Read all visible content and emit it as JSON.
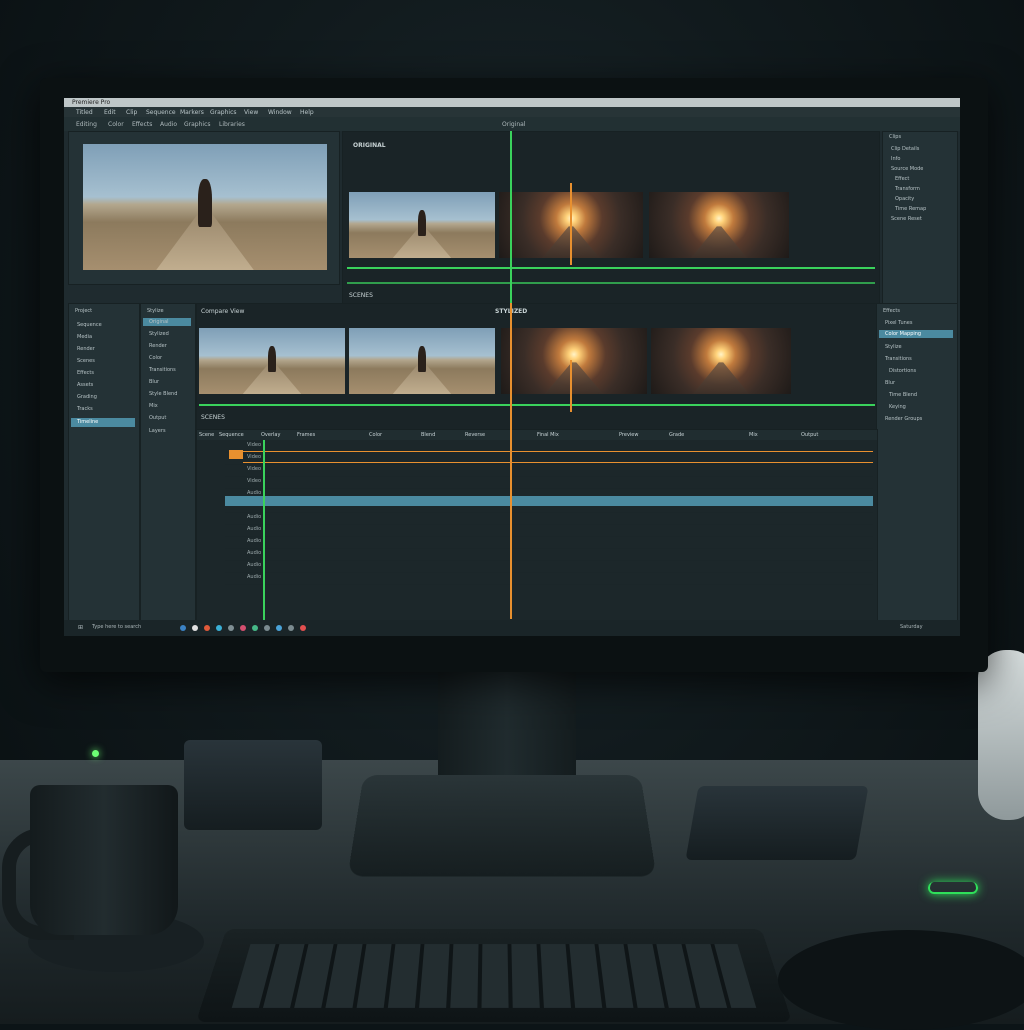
{
  "window": {
    "title": "Premiere Pro"
  },
  "colors": {
    "playhead_green": "#3ad25c",
    "playhead_orange": "#e8902f",
    "selected_track": "#4b8aa0",
    "bg": "#1f2b2f"
  },
  "menu": [
    "Titled",
    "Edit",
    "Clip",
    "Sequence",
    "Markers",
    "Graphics",
    "View",
    "Window",
    "Help"
  ],
  "toolbar": [
    "Editing",
    "Color",
    "Effects",
    "Audio",
    "Graphics",
    "Libraries"
  ],
  "top_bar_center": "Original",
  "viewers": {
    "original_label": "ORIGINAL",
    "stylized_label": "STYLIZED",
    "source_panel_title": "Compare View",
    "scenes_label": "SCENES",
    "original_footer": "SCENES"
  },
  "right_panel_top": {
    "header": "Clips",
    "items": [
      "Clip Details",
      "Info",
      "Source Mode",
      "Effect",
      "Transform",
      "Opacity",
      "Time Remap",
      "Scene Reset"
    ]
  },
  "right_panel_bottom": {
    "header": "Effects",
    "items": [
      "Pixel Tunes",
      "Color Mapping",
      "Stylize",
      "Transitions",
      "Distortions",
      "Blur",
      "Time Blend",
      "Keying",
      "Render Groups"
    ]
  },
  "left_panel": {
    "header": "Project",
    "items": [
      "Sequence",
      "Media",
      "Render",
      "Scenes",
      "Effects",
      "Assets",
      "Grading",
      "Tracks",
      "Timeline"
    ]
  },
  "bin_panel": {
    "header": "Stylize",
    "items": [
      "Original",
      "Stylized",
      "Render",
      "Color",
      "Transitions",
      "Blur",
      "Style Blend",
      "Mix",
      "Output",
      "Layers"
    ]
  },
  "timeline": {
    "ruler": [
      "Scene",
      "Sequence",
      "Overlay",
      "Frames",
      "Color",
      "Blend",
      "Reverse",
      "Final Mix",
      "Preview",
      "Grade",
      "Mix",
      "Output"
    ],
    "tracks": [
      "Video",
      "Video",
      "Video",
      "Video",
      "Audio",
      "Audio",
      "Audio",
      "Audio",
      "Audio",
      "Audio",
      "Audio",
      "Audio"
    ]
  },
  "taskbar": {
    "search": "Type here to search",
    "clock": "Saturday"
  }
}
